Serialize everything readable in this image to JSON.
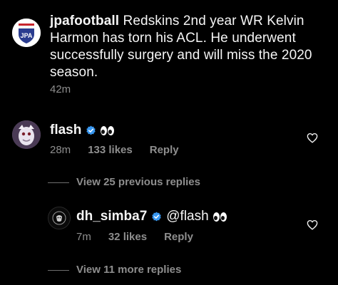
{
  "post": {
    "username": "jpafootball",
    "caption": " Redskins 2nd year WR Kelvin Harmon has torn his ACL. He underwent successfully surgery and will miss the 2020 season.",
    "time": "42m",
    "avatar_logo_text": "JPA"
  },
  "comments": [
    {
      "username": "flash",
      "verified": true,
      "text": "",
      "emoji": "eyes",
      "time": "28m",
      "likes": "133 likes",
      "reply_label": "Reply",
      "view_replies_label": "View 25 previous replies"
    },
    {
      "username": "dh_simba7",
      "verified": true,
      "text": "@flash",
      "emoji": "eyes",
      "time": "7m",
      "likes": "32 likes",
      "reply_label": "Reply",
      "view_replies_label": "View 11 more replies"
    }
  ],
  "colors": {
    "background": "#000000",
    "text": "#f5f5f5",
    "secondary_text": "#8e8e8e",
    "verified_badge": "#3897f0"
  },
  "icons": {
    "like": "heart-outline-icon",
    "verified": "verified-badge-icon"
  }
}
